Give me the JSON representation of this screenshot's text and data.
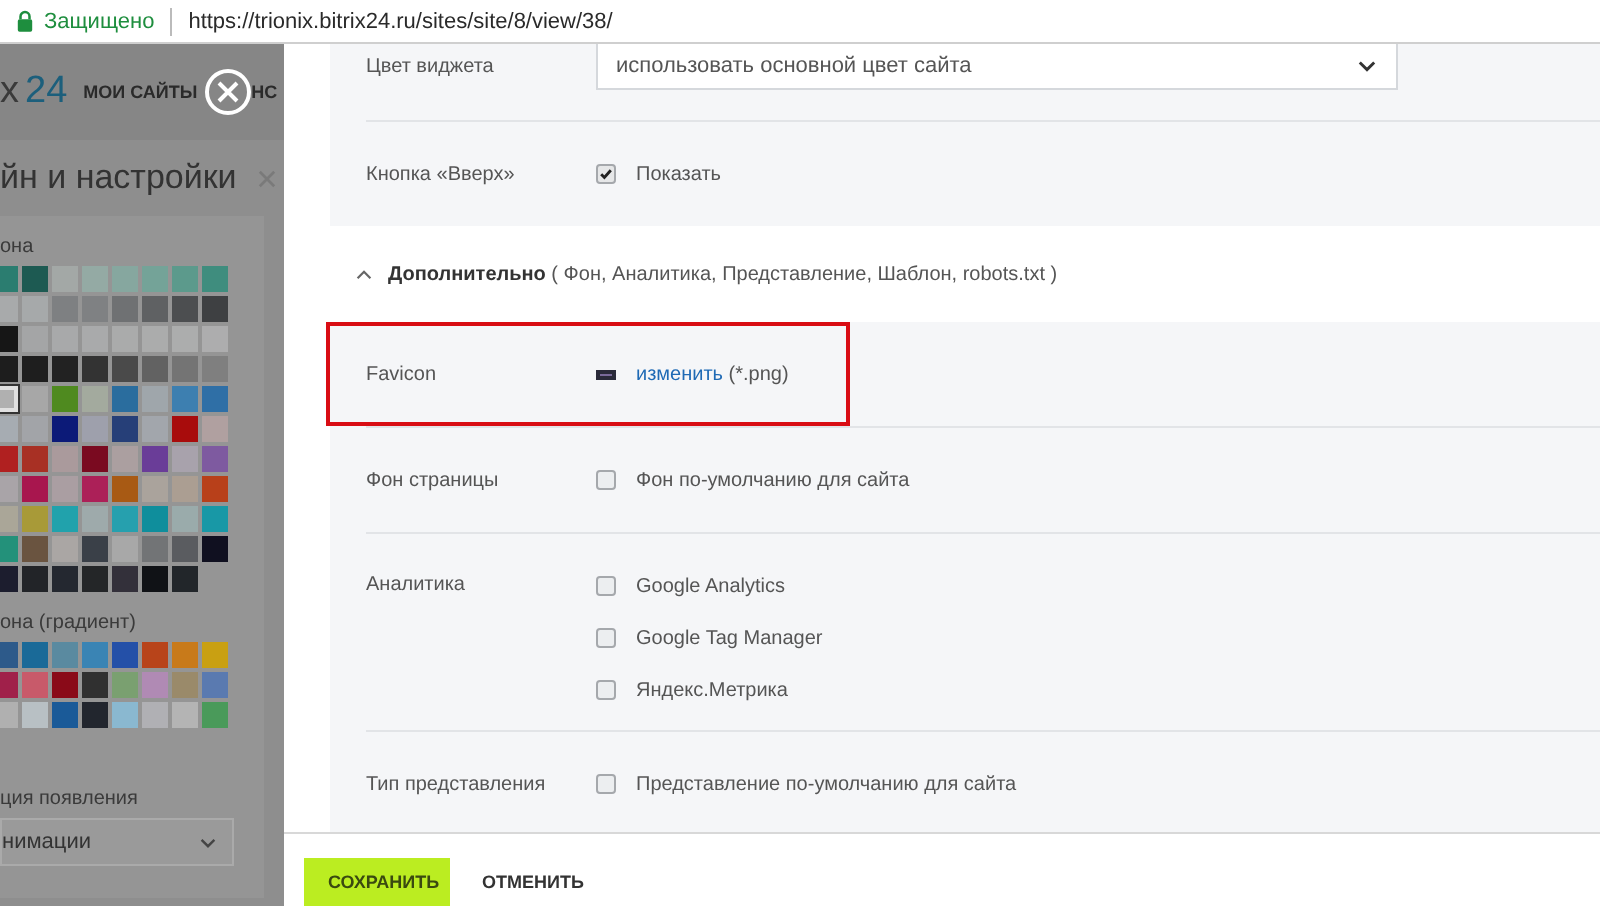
{
  "browser": {
    "security_label": "Защищено",
    "url": "https://trionix.bitrix24.ru/sites/site/8/view/38/"
  },
  "background_page": {
    "logo_prefix": "x",
    "logo_number": "24",
    "nav": [
      "МОИ САЙТЫ",
      "НС"
    ],
    "panel_title": "йн и настройки",
    "sections": [
      {
        "label": "она",
        "swatch_rows": [
          [
            {
              "color": "#2b7d70",
              "selected": false
            },
            {
              "color": "#1d5a52",
              "selected": false
            },
            {
              "color": "#a3a8a6",
              "selected": false
            },
            {
              "color": "#94aaa4",
              "selected": false
            },
            {
              "color": "#86a79f",
              "selected": false
            },
            {
              "color": "#74a398",
              "selected": false
            },
            {
              "color": "#5c9a8c",
              "selected": false
            },
            {
              "color": "#3f8d7e",
              "selected": false
            }
          ],
          [
            {
              "color": "#a8aaab",
              "selected": false
            },
            {
              "color": "#a6a9aa",
              "selected": false
            },
            {
              "color": "#7e8082",
              "selected": false
            },
            {
              "color": "#7f8183",
              "selected": false
            },
            {
              "color": "#6f7173",
              "selected": false
            },
            {
              "color": "#5f6163",
              "selected": false
            },
            {
              "color": "#4c4e50",
              "selected": false
            },
            {
              "color": "#3e4042",
              "selected": false
            }
          ],
          [
            {
              "color": "#161616",
              "selected": false
            },
            {
              "color": "#a4a5a6",
              "selected": false
            },
            {
              "color": "#a8a9aa",
              "selected": false
            },
            {
              "color": "#a9aaab",
              "selected": false
            },
            {
              "color": "#aaabab",
              "selected": false
            },
            {
              "color": "#abacac",
              "selected": false
            },
            {
              "color": "#acadad",
              "selected": false
            },
            {
              "color": "#adadae",
              "selected": false
            }
          ],
          [
            {
              "color": "#1d1d1d",
              "selected": false
            },
            {
              "color": "#1e1e1e",
              "selected": false
            },
            {
              "color": "#222222",
              "selected": false
            },
            {
              "color": "#333333",
              "selected": false
            },
            {
              "color": "#4a4a4a",
              "selected": false
            },
            {
              "color": "#626262",
              "selected": false
            },
            {
              "color": "#747474",
              "selected": false
            },
            {
              "color": "#7f7f7f",
              "selected": false
            }
          ],
          [
            {
              "color": "#b0b0b0",
              "selected": true
            },
            {
              "color": "#a7a7a7",
              "selected": false
            },
            {
              "color": "#4f8a1f",
              "selected": false
            },
            {
              "color": "#a3aa9e",
              "selected": false
            },
            {
              "color": "#2a6d9e",
              "selected": false
            },
            {
              "color": "#9fa6ab",
              "selected": false
            },
            {
              "color": "#3d7fb0",
              "selected": false
            },
            {
              "color": "#2f6fa6",
              "selected": false
            }
          ],
          [
            {
              "color": "#a6acb2",
              "selected": false
            },
            {
              "color": "#a2a4a8",
              "selected": false
            },
            {
              "color": "#0c1a78",
              "selected": false
            },
            {
              "color": "#9ea0ac",
              "selected": false
            },
            {
              "color": "#263f78",
              "selected": false
            },
            {
              "color": "#a2a6ac",
              "selected": false
            },
            {
              "color": "#a80c0c",
              "selected": false
            },
            {
              "color": "#b0a0a0",
              "selected": false
            }
          ],
          [
            {
              "color": "#b02020",
              "selected": false
            },
            {
              "color": "#a83024",
              "selected": false
            },
            {
              "color": "#aa9a9c",
              "selected": false
            },
            {
              "color": "#7a0a20",
              "selected": false
            },
            {
              "color": "#ab9fa0",
              "selected": false
            },
            {
              "color": "#6a3d98",
              "selected": false
            },
            {
              "color": "#a8a2ac",
              "selected": false
            },
            {
              "color": "#7e5aa0",
              "selected": false
            }
          ],
          [
            {
              "color": "#a9a4a8",
              "selected": false
            },
            {
              "color": "#a8164e",
              "selected": false
            },
            {
              "color": "#aa9ea2",
              "selected": false
            },
            {
              "color": "#ac2058",
              "selected": false
            },
            {
              "color": "#a85a14",
              "selected": false
            },
            {
              "color": "#aaa39c",
              "selected": false
            },
            {
              "color": "#ab9e92",
              "selected": false
            },
            {
              "color": "#b8401a",
              "selected": false
            }
          ],
          [
            {
              "color": "#aaa698",
              "selected": false
            },
            {
              "color": "#a89a38",
              "selected": false
            },
            {
              "color": "#21a2ac",
              "selected": false
            },
            {
              "color": "#9eaaab",
              "selected": false
            },
            {
              "color": "#26a0ae",
              "selected": false
            },
            {
              "color": "#0f8e9c",
              "selected": false
            },
            {
              "color": "#9aabab",
              "selected": false
            },
            {
              "color": "#1898a6",
              "selected": false
            }
          ],
          [
            {
              "color": "#23917a",
              "selected": false
            },
            {
              "color": "#6a5440",
              "selected": false
            },
            {
              "color": "#aaa6a4",
              "selected": false
            },
            {
              "color": "#3a4048",
              "selected": false
            },
            {
              "color": "#a8a8a8",
              "selected": false
            },
            {
              "color": "#727476",
              "selected": false
            },
            {
              "color": "#5a5c60",
              "selected": false
            },
            {
              "color": "#101020",
              "selected": false
            }
          ],
          [
            {
              "color": "#1c1d2e",
              "selected": false
            },
            {
              "color": "#222428",
              "selected": false
            },
            {
              "color": "#242830",
              "selected": false
            },
            {
              "color": "#242628",
              "selected": false
            },
            {
              "color": "#33303a",
              "selected": false
            },
            {
              "color": "#101216",
              "selected": false
            },
            {
              "color": "#22262a",
              "selected": false
            }
          ]
        ]
      },
      {
        "label": "она (градиент)",
        "swatch_rows": [
          [
            {
              "color": "#2d5a8a",
              "selected": false
            },
            {
              "color": "#1a6a98",
              "selected": false
            },
            {
              "color": "#5a8aa0",
              "selected": false
            },
            {
              "color": "#3a84b4",
              "selected": false
            },
            {
              "color": "#2450a8",
              "selected": false
            },
            {
              "color": "#b8441a",
              "selected": false
            },
            {
              "color": "#c87a1a",
              "selected": false
            },
            {
              "color": "#c9a012",
              "selected": false
            }
          ],
          [
            {
              "color": "#a0204a",
              "selected": false
            },
            {
              "color": "#c85a6a",
              "selected": false
            },
            {
              "color": "#8a0a18",
              "selected": false
            },
            {
              "color": "#303030",
              "selected": false
            },
            {
              "color": "#7aa070",
              "selected": false
            },
            {
              "color": "#b08ab4",
              "selected": false
            },
            {
              "color": "#9a8a6a",
              "selected": false
            },
            {
              "color": "#5a7ab0",
              "selected": false
            }
          ],
          [
            {
              "color": "#b0b0b0",
              "selected": false
            },
            {
              "color": "#b8c0c4",
              "selected": false
            },
            {
              "color": "#1a5a98",
              "selected": false
            },
            {
              "color": "#22262e",
              "selected": false
            },
            {
              "color": "#8ab8d0",
              "selected": false
            },
            {
              "color": "#b0b0b4",
              "selected": false
            },
            {
              "color": "#b4b4b4",
              "selected": false
            },
            {
              "color": "#4a9a5a",
              "selected": false
            }
          ]
        ]
      }
    ],
    "appearance": {
      "label": "ция появления",
      "value": "нимации"
    }
  },
  "settings": {
    "rows": [
      {
        "kind": "select",
        "label": "Цвет виджета",
        "value": "использовать основной цвет сайта"
      },
      {
        "kind": "checkboxes",
        "label": "Кнопка «Вверх»",
        "options": [
          {
            "label": "Показать",
            "checked": true
          }
        ]
      }
    ],
    "advanced": {
      "expanded": true,
      "title": "Дополнительно",
      "details": "( Фон,  Аналитика,  Представление,  Шаблон,  robots.txt )"
    },
    "advanced_rows": [
      {
        "kind": "file",
        "label": "Favicon",
        "highlighted": true,
        "link": "изменить",
        "hint": "(*.png)"
      },
      {
        "kind": "checkboxes",
        "label": "Фон страницы",
        "options": [
          {
            "label": "Фон по-умолчанию для сайта",
            "checked": false
          }
        ]
      },
      {
        "kind": "checkboxes",
        "label": "Аналитика",
        "options": [
          {
            "label": "Google Analytics",
            "checked": false
          },
          {
            "label": "Google Tag Manager",
            "checked": false
          },
          {
            "label": "Яндекс.Метрика",
            "checked": false
          }
        ]
      },
      {
        "kind": "checkboxes",
        "label": "Тип представления",
        "options": [
          {
            "label": "Представление по-умолчанию для сайта",
            "checked": false
          }
        ]
      }
    ]
  },
  "footer": {
    "buttons": [
      {
        "kind": "primary",
        "label": "СОХРАНИТЬ"
      },
      {
        "kind": "link",
        "label": "ОТМЕНИТЬ"
      }
    ]
  }
}
